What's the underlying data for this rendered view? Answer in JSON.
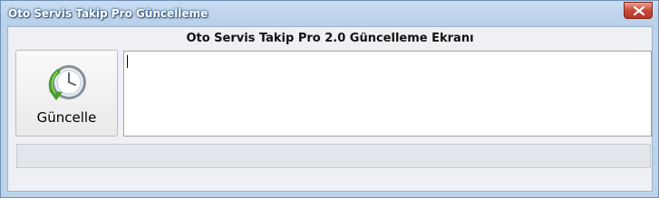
{
  "window": {
    "title": "Oto Servis Takip Pro Güncelleme"
  },
  "header": {
    "title": "Oto Servis Takip Pro 2.0 Güncelleme Ekranı"
  },
  "update_button": {
    "label": "Güncelle",
    "icon": "clock-update-arrow-icon"
  },
  "log": {
    "value": ""
  },
  "progress": {
    "value": 0
  },
  "colors": {
    "title_bar": "#bcd3ea",
    "client_background": "#eef0f3",
    "close_button": "#c8493a"
  }
}
